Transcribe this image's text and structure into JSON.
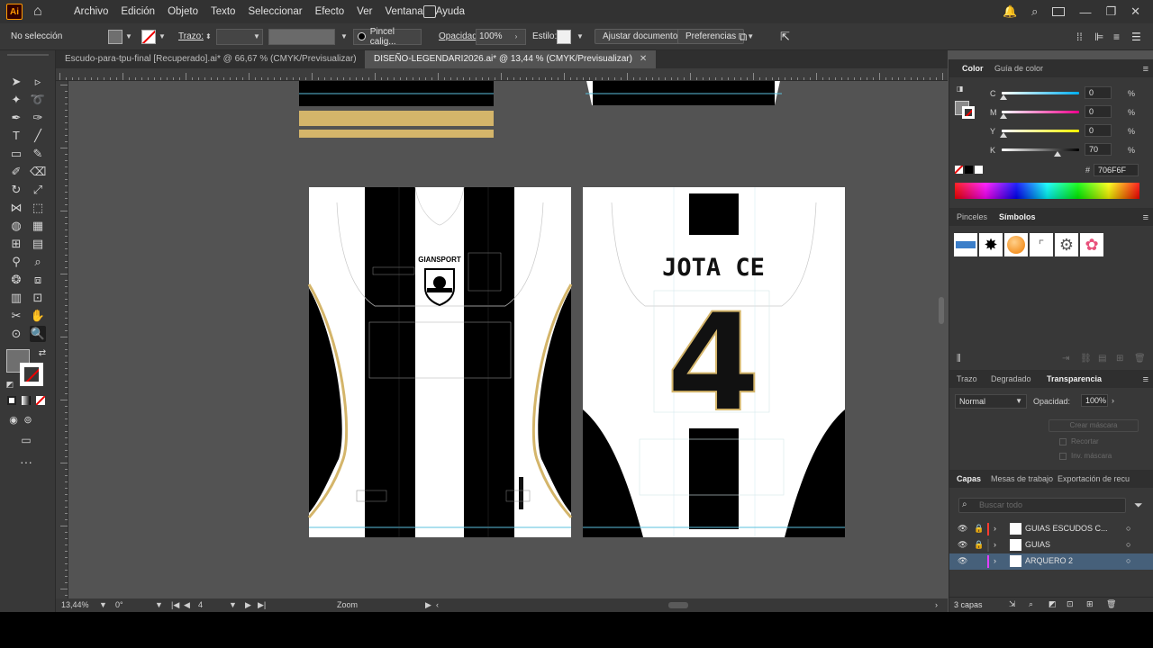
{
  "app": {
    "logo": "Ai",
    "menu": [
      "Archivo",
      "Edición",
      "Objeto",
      "Texto",
      "Seleccionar",
      "Efecto",
      "Ver",
      "Ventana",
      "Ayuda"
    ]
  },
  "control": {
    "selection": "No selección",
    "stroke_label": "Trazo:",
    "brush": "Pincel calig...",
    "opacity_label": "Opacidad:",
    "opacity_value": "100%",
    "style_label": "Estilo:",
    "adjust_doc": "Ajustar documento",
    "preferences": "Preferencias"
  },
  "tabs": [
    {
      "title": "Escudo-para-tpu-final [Recuperado].ai* @ 66,67 % (CMYK/Previsualizar)"
    },
    {
      "title": "DISEÑO-LEGENDARI2026.ai* @ 13,44 % (CMYK/Previsualizar)"
    }
  ],
  "artwork": {
    "brand": "GIANSPORT",
    "player_name": "JOTA CE",
    "player_number": "4",
    "colors": {
      "black": "#000000",
      "white": "#ffffff",
      "gold": "#d4b56a",
      "guide": "#5bc0de"
    }
  },
  "status": {
    "zoom": "13,44%",
    "rotation": "0°",
    "artboard": "4",
    "tool": "Zoom"
  },
  "color_panel": {
    "tabs": [
      "Color",
      "Guía de color"
    ],
    "channels": [
      {
        "label": "C",
        "value": "0",
        "unit": "%"
      },
      {
        "label": "M",
        "value": "0",
        "unit": "%"
      },
      {
        "label": "Y",
        "value": "0",
        "unit": "%"
      },
      {
        "label": "K",
        "value": "70",
        "unit": "%"
      }
    ],
    "hex_prefix": "#",
    "hex": "706F6F"
  },
  "symbols_panel": {
    "tabs": [
      "Pinceles",
      "Símbolos"
    ]
  },
  "transparency_panel": {
    "tabs": [
      "Trazo",
      "Degradado",
      "Transparencia"
    ],
    "blend_mode": "Normal",
    "opacity_label": "Opacidad:",
    "opacity_value": "100%",
    "make_mask": "Crear máscara",
    "clip": "Recortar",
    "invert_mask": "Inv. máscara"
  },
  "layers_panel": {
    "tabs": [
      "Capas",
      "Mesas de trabajo",
      "Exportación de recu"
    ],
    "search_placeholder": "Buscar todo",
    "layers": [
      {
        "name": "GUIAS ESCUDOS C...",
        "color": "#ff3b30"
      },
      {
        "name": "GUIAS",
        "color": "#4a4a4a"
      },
      {
        "name": "ARQUERO 2",
        "color": "#e040fb"
      }
    ],
    "count": "3 capas"
  }
}
